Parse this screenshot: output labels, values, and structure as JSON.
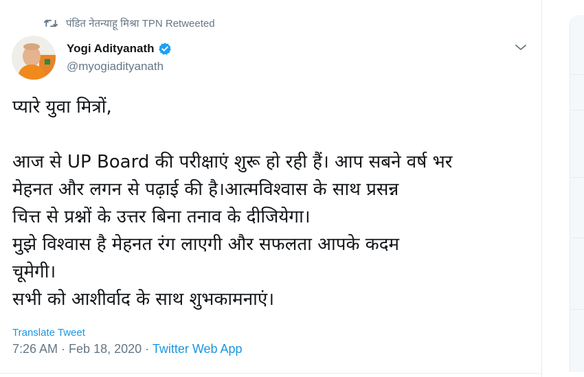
{
  "retweet": {
    "icon": "retweet-icon",
    "text": "पंडित नेतन्याहू मिश्रा TPN Retweeted"
  },
  "author": {
    "name": "Yogi Adityanath",
    "handle": "@myogiadityanath",
    "verified": true,
    "avatar_icon": "profile-avatar"
  },
  "tweet": {
    "lines": [
      "प्यारे युवा मित्रों,",
      "",
      "आज से UP Board की परीक्षाएं शुरू हो रही हैं। आप सबने वर्ष भर",
      "मेहनत और लगन से पढ़ाई की है।आत्मविश्वास के साथ प्रसन्न",
      "चित्त से प्रश्नों के उत्तर बिना तनाव के दीजियेगा।",
      "मुझे विश्वास है मेहनत रंग लाएगी और सफलता आपके कदम",
      "चूमेगी।",
      "सभी को आशीर्वाद के साथ शुभकामनाएं।"
    ]
  },
  "actions": {
    "translate_label": "Translate Tweet"
  },
  "meta": {
    "time": "7:26 AM",
    "separator1": " · ",
    "date": "Feb 18, 2020",
    "separator2": " · ",
    "app": "Twitter Web App"
  },
  "colors": {
    "link": "#1b95e0",
    "secondary_text": "#657786",
    "primary_text": "#14171a",
    "border": "#e6ecf0"
  }
}
